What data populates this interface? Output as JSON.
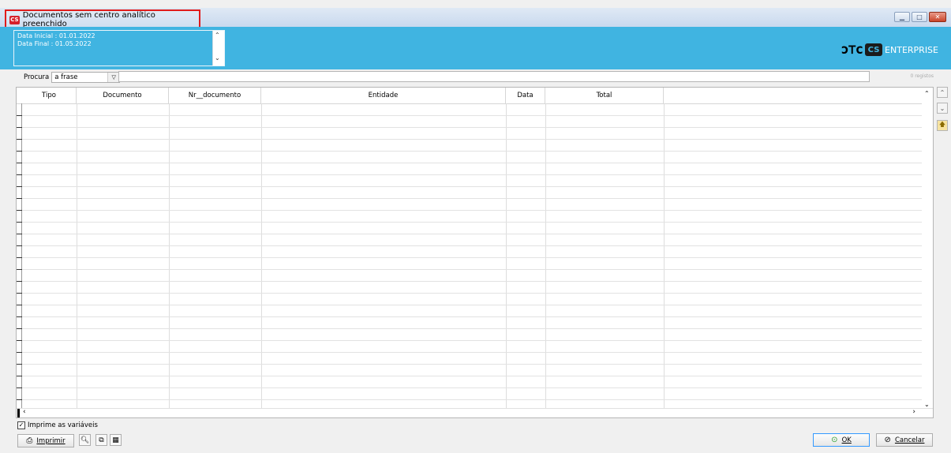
{
  "window": {
    "title": "Documentos sem centro analítico preenchido",
    "app_icon": "cs-logo",
    "controls": [
      "minimize",
      "maximize",
      "close"
    ]
  },
  "header": {
    "params": [
      "Data Inicial : 01.01.2022",
      "Data Final : 01.05.2022"
    ],
    "brand": {
      "phc": "ɔ⊤c",
      "cs": "CS",
      "enterprise": "ENTERPRISE"
    },
    "accent_color": "#40b4e1"
  },
  "search": {
    "label": "Procura",
    "mode": "a frase",
    "value": "",
    "records": "0 registos"
  },
  "grid": {
    "columns": [
      "Tipo",
      "Documento",
      "Nr__documento",
      "Entidade",
      "Data",
      "Total"
    ],
    "rows": []
  },
  "side_buttons": [
    "chevron-up-icon",
    "chevron-down-icon",
    "folder-up-icon"
  ],
  "footer": {
    "print_vars_label": "Imprime as variáveis",
    "print_vars_checked": true,
    "print_button": "Imprimir",
    "ok_button": "OK",
    "cancel_button": "Cancelar"
  }
}
